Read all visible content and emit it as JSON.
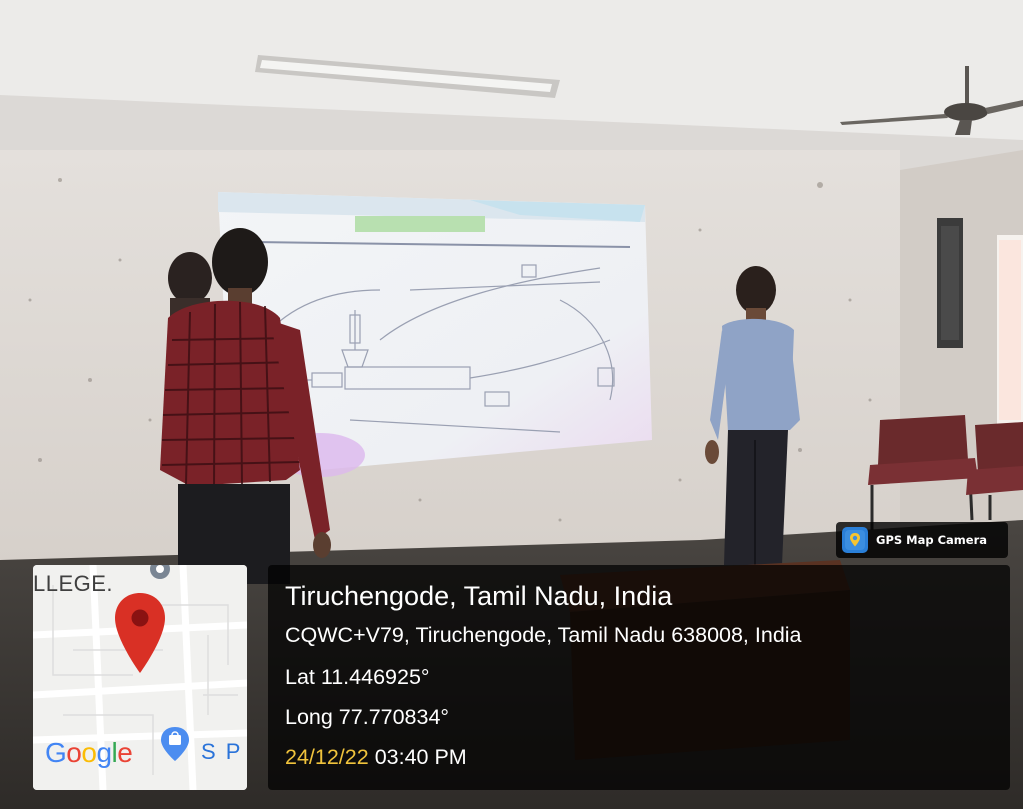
{
  "badge": {
    "text": "GPS Map Camera",
    "icon": "map-pin-app-icon"
  },
  "map": {
    "place_label": "LLEGE.",
    "google": [
      "G",
      "o",
      "o",
      "g",
      "l",
      "e"
    ],
    "google_colors": [
      "#4285F4",
      "#EA4335",
      "#FBBC05",
      "#4285F4",
      "#34A853",
      "#EA4335"
    ],
    "shop_label": "S P",
    "pin_color": "#d93025"
  },
  "overlay": {
    "title": "Tiruchengode, Tamil Nadu, India",
    "address": "CQWC+V79, Tiruchengode, Tamil Nadu 638008, India",
    "lat": "Lat 11.446925°",
    "long": "Long 77.770834°",
    "date": "24/12/22",
    "time": "03:40 PM"
  }
}
